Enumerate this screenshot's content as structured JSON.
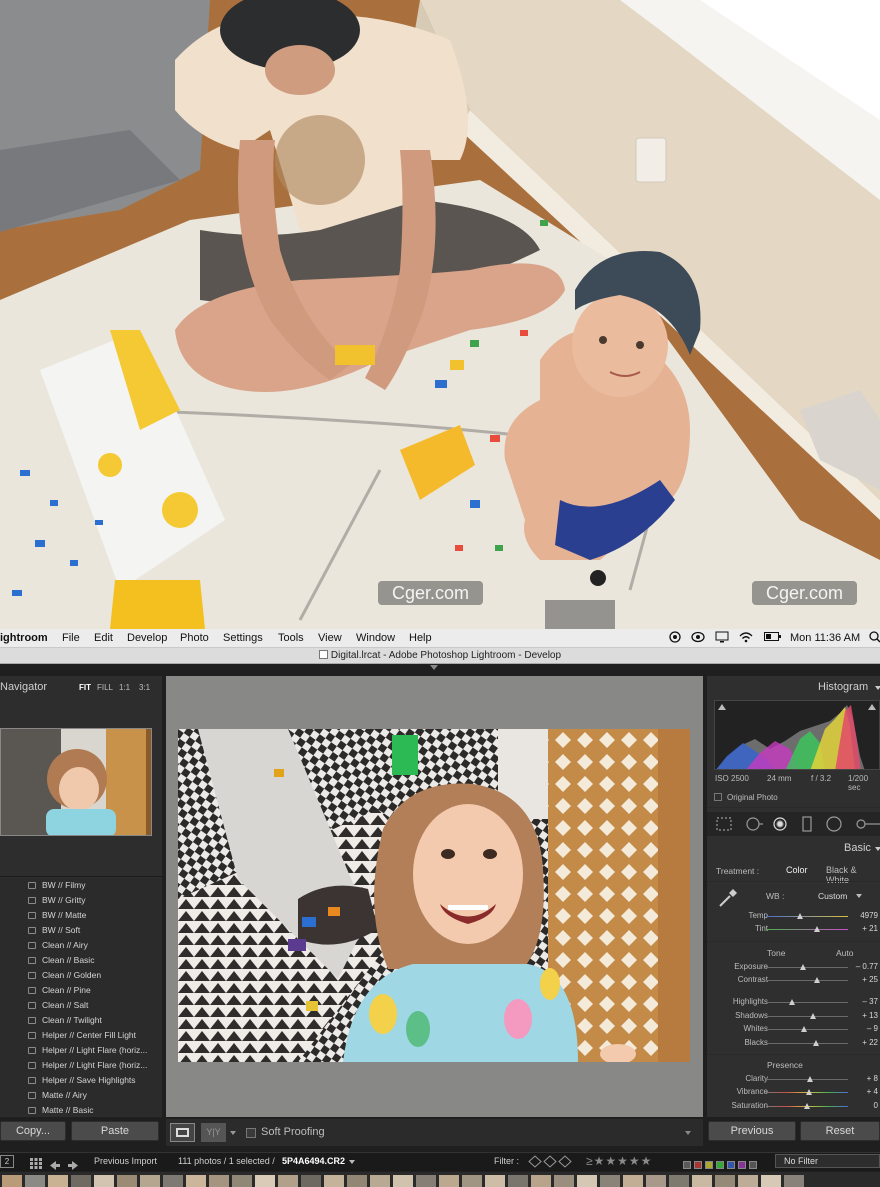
{
  "watermark": {
    "left": "Cger.com",
    "right": "Cger.com"
  },
  "menubar": {
    "app": "ightroom",
    "menus": [
      "File",
      "Edit",
      "Develop",
      "Photo",
      "Settings",
      "Tools",
      "View",
      "Window",
      "Help"
    ],
    "clock": "Mon 11:36 AM"
  },
  "titlebar": {
    "title": "Digital.lrcat - Adobe Photoshop Lightroom - Develop"
  },
  "navigator": {
    "title": "Navigator",
    "zoom": [
      "FIT",
      "FILL",
      "1:1",
      "3:1"
    ]
  },
  "presets": [
    "BW // Filmy",
    "BW // Gritty",
    "BW // Matte",
    "BW // Soft",
    "Clean // Airy",
    "Clean // Basic",
    "Clean // Golden",
    "Clean // Pine",
    "Clean // Salt",
    "Clean // Twilight",
    "Helper // Center Fill Light",
    "Helper // Light Flare (horiz...",
    "Helper // Light Flare (horiz...",
    "Helper // Save Highlights",
    "Matte // Airy",
    "Matte // Basic"
  ],
  "left_buttons": {
    "copy": "Copy...",
    "paste": "Paste"
  },
  "toolbar": {
    "yy": "Y|Y",
    "soft_proofing": "Soft Proofing"
  },
  "histogram": {
    "title": "Histogram",
    "iso": "ISO 2500",
    "focal": "24 mm",
    "aperture": "f / 3.2",
    "shutter": "1/200 sec",
    "original_photo": "Original Photo"
  },
  "basic": {
    "title": "Basic",
    "treatment_label": "Treatment :",
    "treatment_color": "Color",
    "treatment_bw": "Black & White",
    "wb_label": "WB :",
    "wb_value": "Custom",
    "tone_label": "Tone",
    "auto_label": "Auto",
    "presence_label": "Presence",
    "sliders": [
      {
        "name": "temp",
        "label": "Temp",
        "value": "4979",
        "pos": 0.42
      },
      {
        "name": "tint",
        "label": "Tint",
        "value": "+ 21",
        "pos": 0.62
      },
      {
        "name": "exposure",
        "label": "Exposure",
        "value": "– 0.77",
        "pos": 0.45
      },
      {
        "name": "contrast",
        "label": "Contrast",
        "value": "+ 25",
        "pos": 0.62
      },
      {
        "name": "highlights",
        "label": "Highlights",
        "value": "– 37",
        "pos": 0.32
      },
      {
        "name": "shadows",
        "label": "Shadows",
        "value": "+ 13",
        "pos": 0.57
      },
      {
        "name": "whites",
        "label": "Whites",
        "value": "– 9",
        "pos": 0.46
      },
      {
        "name": "blacks",
        "label": "Blacks",
        "value": "+ 22",
        "pos": 0.61
      },
      {
        "name": "clarity",
        "label": "Clarity",
        "value": "+ 8",
        "pos": 0.54
      },
      {
        "name": "vibrance",
        "label": "Vibrance",
        "value": "+ 4",
        "pos": 0.52
      },
      {
        "name": "saturation",
        "label": "Saturation",
        "value": "0",
        "pos": 0.5
      }
    ]
  },
  "right_buttons": {
    "previous": "Previous",
    "reset": "Reset"
  },
  "filmstrip": {
    "page": "2",
    "source": "Previous Import",
    "count": "111 photos / 1 selected /",
    "filename": "5P4A6494.CR2",
    "filter_label": "Filter :",
    "no_filter": "No Filter"
  }
}
